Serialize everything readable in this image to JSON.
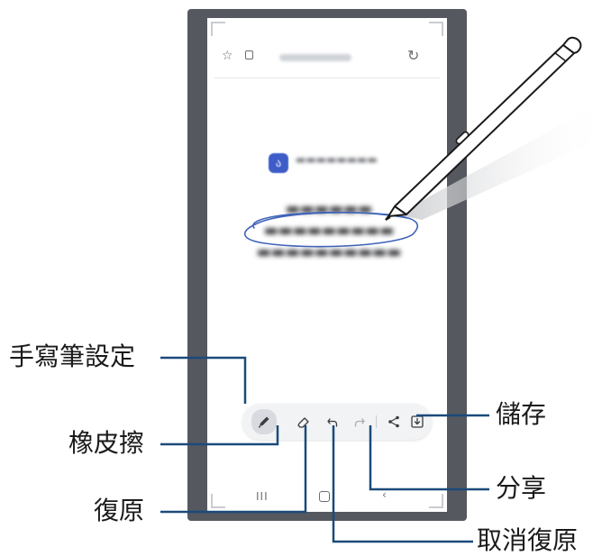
{
  "colors": {
    "frame": "#55585e",
    "screen": "#ffffff",
    "callout_line": "#1b4a7a",
    "handwriting": "#3f63b8",
    "pen_body": "#ffffff",
    "label_text": "#1a1a1a"
  },
  "browser": {
    "star_icon": "star-icon",
    "lock_icon": "lock-icon",
    "reload_icon": "reload-icon"
  },
  "page_content": {
    "logo_glyph": "ა"
  },
  "toolbar": {
    "buttons": [
      {
        "icon": "pen-settings-icon",
        "active": true
      },
      {
        "icon": "eraser-icon",
        "active": false
      },
      {
        "icon": "undo-icon",
        "active": false
      },
      {
        "icon": "redo-icon",
        "active": false
      },
      {
        "icon": "share-icon",
        "active": false
      },
      {
        "icon": "save-icon",
        "active": false
      }
    ]
  },
  "nav": {
    "recents_glyph": "III",
    "back_glyph": "‹"
  },
  "callouts": {
    "pen_settings": "手寫筆設定",
    "eraser": "橡皮擦",
    "undo": "復原",
    "redo": "取消復原",
    "share": "分享",
    "save": "儲存"
  }
}
